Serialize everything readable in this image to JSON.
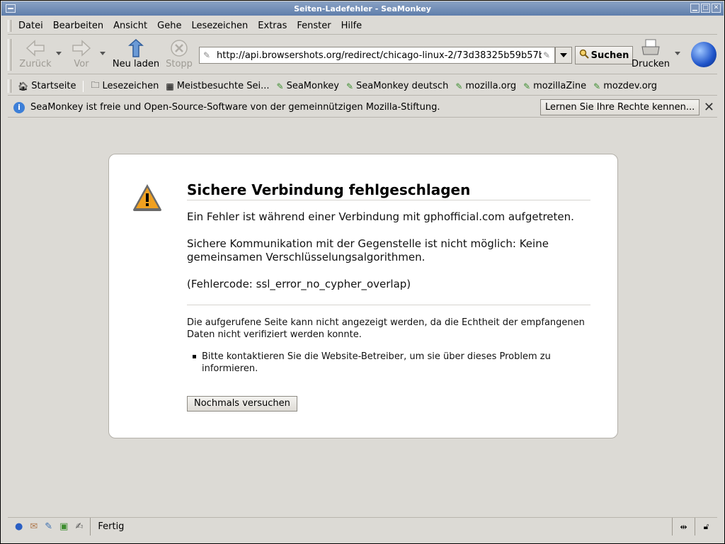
{
  "window": {
    "title": "Seiten-Ladefehler - SeaMonkey"
  },
  "menubar": {
    "items": [
      "Datei",
      "Bearbeiten",
      "Ansicht",
      "Gehe",
      "Lesezeichen",
      "Extras",
      "Fenster",
      "Hilfe"
    ]
  },
  "navbar": {
    "back": "Zurück",
    "forward": "Vor",
    "reload": "Neu laden",
    "stop": "Stopp",
    "url": "http://api.browsershots.org/redirect/chicago-linux-2/73d38325b59b57b",
    "search": "Suchen",
    "print": "Drucken"
  },
  "bookmarks": {
    "home": "Startseite",
    "bookmarks": "Lesezeichen",
    "most_visited": "Meistbesuchte Sei...",
    "items": [
      "SeaMonkey",
      "SeaMonkey deutsch",
      "mozilla.org",
      "mozillaZine",
      "mozdev.org"
    ]
  },
  "notification": {
    "message": "SeaMonkey ist freie und Open-Source-Software von der gemeinnützigen Mozilla-Stiftung.",
    "button": "Lernen Sie Ihre Rechte kennen..."
  },
  "error": {
    "title": "Sichere Verbindung fehlgeschlagen",
    "line1": "Ein Fehler ist während einer Verbindung mit gphofficial.com aufgetreten.",
    "line2": "Sichere Kommunikation mit der Gegenstelle ist nicht möglich: Keine gemeinsamen Verschlüsselungsalgorithmen.",
    "line3": "(Fehlercode: ssl_error_no_cypher_overlap)",
    "description": "Die aufgerufene Seite kann nicht angezeigt werden, da die Echtheit der empfangenen Daten nicht verifiziert werden konnte.",
    "bullet": "Bitte kontaktieren Sie die Website-Betreiber, um sie über dieses Problem zu informieren.",
    "retry": "Nochmals versuchen"
  },
  "statusbar": {
    "text": "Fertig"
  },
  "colors": {
    "chrome": "#dcdad5",
    "titlebar": "#6d89b3",
    "warning": "#f0a020"
  }
}
